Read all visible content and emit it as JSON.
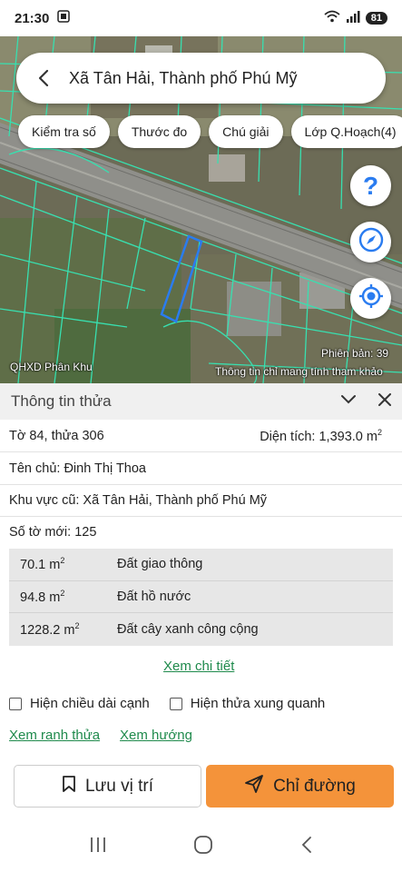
{
  "status": {
    "time": "21:30",
    "battery": "81"
  },
  "search": {
    "title": "Xã Tân Hải, Thành phố Phú Mỹ"
  },
  "chips": [
    "Kiểm tra số",
    "Thước đo",
    "Chú giải",
    "Lớp Q.Hoạch(4)"
  ],
  "map": {
    "layer_label": "QHXD Phân Khu",
    "version_label": "Phiên bản: 39",
    "disclaimer": "Thông tin chỉ mang tính tham khảo",
    "help_glyph": "?",
    "colors": {
      "parcel_lines": "#38e0b0",
      "selected_parcel": "#2a7cf0"
    }
  },
  "panel": {
    "title": "Thông tin thửa",
    "sheet_parcel": "Tờ 84, thửa 306",
    "area_label": "Diện tích: ",
    "area_value": "1,393.0 m",
    "area_sup": "2",
    "owner": "Tên chủ: Đinh Thị Thoa",
    "old_area": "Khu vực cũ: Xã Tân Hải, Thành phố Phú Mỹ",
    "new_sheet": "Số tờ mới: 125"
  },
  "land_uses": [
    {
      "area": "70.1 m",
      "sup": "2",
      "type": "Đất giao thông"
    },
    {
      "area": "94.8 m",
      "sup": "2",
      "type": "Đất hồ nước"
    },
    {
      "area": "1228.2 m",
      "sup": "2",
      "type": "Đất cây xanh công cộng"
    }
  ],
  "links": {
    "detail": "Xem chi tiết",
    "boundary": "Xem ranh thửa",
    "direction": "Xem hướng"
  },
  "checks": {
    "edge_length": "Hiện chiều dài cạnh",
    "surrounding": "Hiện thửa xung quanh"
  },
  "buttons": {
    "save": "Lưu vị trí",
    "route": "Chỉ đường"
  },
  "accent_color": "#f4933a"
}
